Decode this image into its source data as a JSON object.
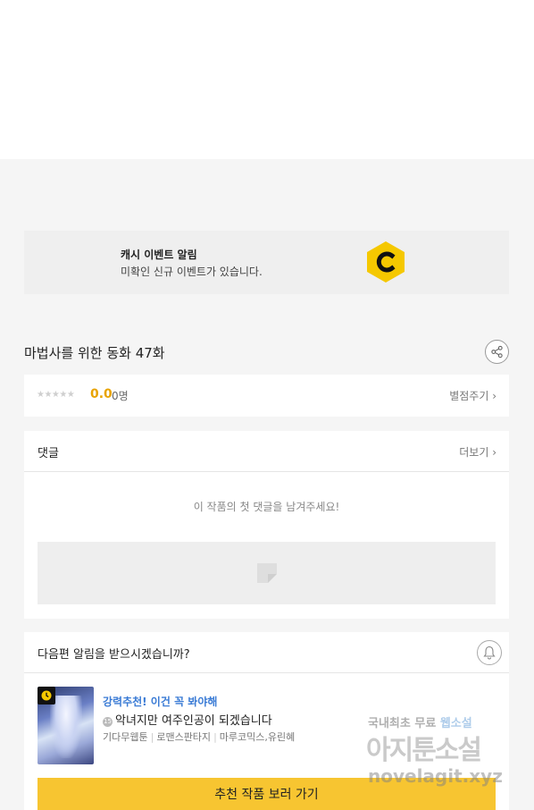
{
  "cash_event": {
    "title": "캐시 이벤트 알림",
    "description": "미확인 신규 이벤트가 있습니다.",
    "logo_icon": "cash-c-logo-icon",
    "accent": "#f5c800"
  },
  "episode": {
    "title": "마법사를 위한 동화 47화",
    "share_icon": "share-icon"
  },
  "rating": {
    "stars": "★★★★★",
    "score": "0.0",
    "count": "0명",
    "rate_link": "별점주기 ›",
    "score_color": "#e8a300"
  },
  "comments": {
    "title": "댓글",
    "more": "더보기 ›",
    "empty_message": "이 작품의 첫 댓글을 남겨주세요!"
  },
  "notification": {
    "title": "다음편 알림을 받으시겠습니까?",
    "bell_icon": "bell-icon"
  },
  "recommendation": {
    "tag": "강력추천! 이건 꼭 봐야해",
    "age_badge": "15",
    "title": "악녀지만 여주인공이 되겠습니다",
    "meta": [
      "기다무웹툰",
      "로맨스판타지",
      "마루코믹스,유린혜"
    ],
    "cta": "추천 작품 보러 가기",
    "cta_color": "#f7c531",
    "tag_color": "#3a7bd5"
  },
  "watermark": {
    "line1_a": "국내최초 무료",
    "line1_b": "웹소설",
    "line2": "아지툰소설",
    "line3": "novelagit.xyz"
  }
}
